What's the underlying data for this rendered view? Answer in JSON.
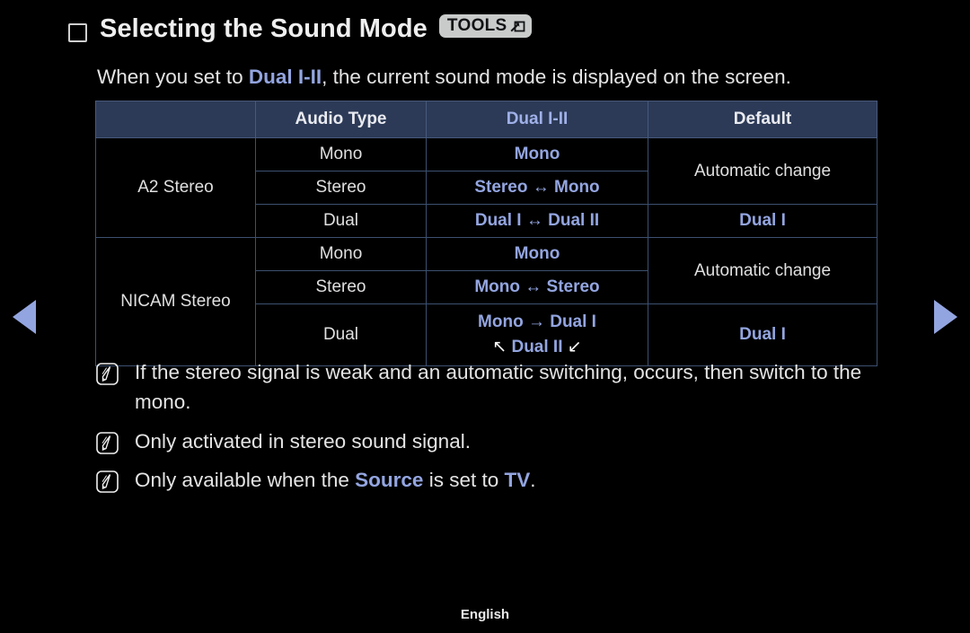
{
  "page": {
    "title": "Selecting the Sound Mode",
    "bullet_icon": "square-outline-icon",
    "tools_badge_label": "TOOLS",
    "tools_badge_icon": "open-in-new-icon",
    "subtitle_pre": "When you set to ",
    "subtitle_accent": "Dual I-II",
    "subtitle_post": ", the current sound mode is displayed on the screen.",
    "footer_language": "English"
  },
  "nav": {
    "prev_icon": "triangle-left-icon",
    "next_icon": "triangle-right-icon"
  },
  "colors": {
    "accent": "#93a5e0",
    "header_bg": "#2c3a57",
    "border": "#3c5070",
    "background": "#000000",
    "text": "#e4e4e4",
    "badge_bg": "#c9cbcb"
  },
  "table": {
    "headers": [
      "",
      "Audio Type",
      "Dual I-II",
      "Default"
    ],
    "header_accent_index": 2,
    "rows": [
      {
        "group": "A2 Stereo",
        "group_rowspan": 3,
        "audio_type": "Mono",
        "dual": "Mono",
        "default": "Automatic change",
        "default_rowspan": 2
      },
      {
        "group": null,
        "audio_type": "Stereo",
        "dual": "Stereo ↔ Mono",
        "default": null
      },
      {
        "group": null,
        "audio_type": "Dual",
        "dual": "Dual I ↔ Dual II",
        "default": "Dual I",
        "default_rowspan": 1
      },
      {
        "group": "NICAM Stereo",
        "group_rowspan": 3,
        "audio_type": "Mono",
        "dual": "Mono",
        "default": "Automatic change",
        "default_rowspan": 2
      },
      {
        "group": null,
        "audio_type": "Stereo",
        "dual": "Mono ↔ Stereo",
        "default": null
      },
      {
        "group": null,
        "audio_type": "Dual",
        "dual_line1": "Mono → Dual I",
        "dual_line2_pre": "↖",
        "dual_line2_mid": "Dual II",
        "dual_line2_post": "↙",
        "default": "Dual I",
        "default_rowspan": 1
      }
    ]
  },
  "notes": [
    {
      "icon": "note-pen-icon",
      "text": "If the stereo signal is weak and an automatic switching, occurs, then switch to the mono."
    },
    {
      "icon": "note-pen-icon",
      "text": "Only activated in stereo sound signal."
    },
    {
      "icon": "note-pen-icon",
      "text_pre": "Only available when the ",
      "text_accent1": "Source",
      "text_mid": " is set to ",
      "text_accent2": "TV",
      "text_post": "."
    }
  ]
}
